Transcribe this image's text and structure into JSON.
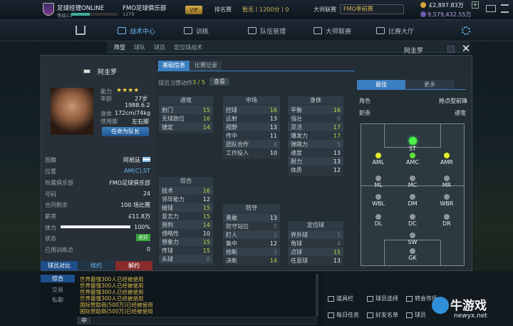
{
  "topbar": {
    "game_title": "足球经理ONLINE",
    "level": "等级11",
    "club_name": "FMO足球俱乐部",
    "club_sub": "1279",
    "vip": "VIP",
    "rank_label": "排名赛",
    "rank_info": "暂无丨1200分丨0",
    "master_label": "大师联赛",
    "master_info": "FMO季前赛",
    "coins": "£2,897.83万",
    "money2": "9,579,432.55万"
  },
  "nav": {
    "tactics": "战术中心",
    "training": "训练",
    "team": "队伍管理",
    "master": "大师联赛",
    "match": "比赛大厅"
  },
  "subtabs": [
    "阵型",
    "球队",
    "球员",
    "定位球战术"
  ],
  "player": {
    "header_name": "阿圭罗",
    "name": "阿圭罗",
    "ability_label": "能力",
    "age_label": "年龄",
    "age": "27岁",
    "birth": "1988.6.2",
    "body_label": "身体",
    "body": "172cm/74kg",
    "foot_label": "惯用脚",
    "foot": "左右脚",
    "captain_btn": "任命为队长",
    "stars": "★★★★",
    "info": [
      {
        "k": "国籍",
        "v": "阿根廷"
      },
      {
        "k": "位置",
        "v": "AM(C),ST"
      },
      {
        "k": "所属俱乐部",
        "v": "FMO足球俱乐部"
      },
      {
        "k": "号码",
        "v": "24"
      },
      {
        "k": "合同剩余",
        "v": "100 场比赛"
      },
      {
        "k": "薪资",
        "v": "£11.8万"
      },
      {
        "k": "体力",
        "v": "100%"
      },
      {
        "k": "状态",
        "v": "良好"
      },
      {
        "k": "已用训练点",
        "v": "0"
      }
    ],
    "stamina": 100
  },
  "actions": {
    "compare": "球员对比",
    "renew": "续约",
    "release": "解约"
  },
  "tabs": {
    "basic": "基础信息",
    "records": "比赛记录"
  },
  "habit": {
    "label": "球员习惯动作",
    "value": "3 / 5",
    "view": "查看"
  },
  "attrs": {
    "attack": {
      "title": "进攻",
      "rows": [
        [
          "射门",
          "15"
        ],
        [
          "无球跑位",
          "16"
        ],
        [
          "镇定",
          "14"
        ]
      ]
    },
    "general": {
      "title": "综合",
      "rows": [
        [
          "技术",
          "16"
        ],
        [
          "领导能力",
          "12"
        ],
        [
          "接球",
          "15"
        ],
        [
          "意志力",
          "15"
        ],
        [
          "预判",
          "14"
        ],
        [
          "侵略性",
          "10"
        ],
        [
          "想象力",
          "15"
        ],
        [
          "传球",
          "15"
        ],
        [
          "头球",
          "8"
        ]
      ]
    },
    "midfield": {
      "title": "中场",
      "rows": [
        [
          "控球",
          "16"
        ],
        [
          "远射",
          "13"
        ],
        [
          "视野",
          "13"
        ],
        [
          "传中",
          "11"
        ],
        [
          "团队合作",
          "8"
        ],
        [
          "工作投入",
          "10"
        ]
      ]
    },
    "defense": {
      "title": "防守",
      "rows": [
        [
          "勇敢",
          "13"
        ],
        [
          "防守站位",
          "5"
        ],
        [
          "盯人",
          "2"
        ],
        [
          "集中",
          "12"
        ],
        [
          "抢断",
          "3"
        ],
        [
          "决断",
          "14"
        ]
      ]
    },
    "physical": {
      "title": "身体",
      "rows": [
        [
          "平衡",
          "16"
        ],
        [
          "强壮",
          "8"
        ],
        [
          "灵活",
          "17"
        ],
        [
          "爆发力",
          "17"
        ],
        [
          "弹跳力",
          "5"
        ],
        [
          "速度",
          "13"
        ],
        [
          "耐力",
          "13"
        ],
        [
          "体质",
          "12"
        ]
      ]
    },
    "setpiece": {
      "title": "定位球",
      "rows": [
        [
          "界外球",
          "1"
        ],
        [
          "角球",
          "4"
        ],
        [
          "点球",
          "15"
        ],
        [
          "任意球",
          "13"
        ]
      ]
    }
  },
  "right": {
    "tab_best": "最佳",
    "tab_more": "更多",
    "role_label": "角色",
    "role_value": "抢点型前锋",
    "duty_label": "职责",
    "duty_value": "进攻"
  },
  "positions": [
    {
      "n": "ST",
      "c": "big"
    },
    {
      "n": "AML",
      "c": "y"
    },
    {
      "n": "AMC",
      "c": "g"
    },
    {
      "n": "AMR",
      "c": "y"
    },
    {
      "n": "ML",
      "c": ""
    },
    {
      "n": "MC",
      "c": ""
    },
    {
      "n": "MR",
      "c": ""
    },
    {
      "n": "WBL",
      "c": ""
    },
    {
      "n": "DM",
      "c": ""
    },
    {
      "n": "WBR",
      "c": ""
    },
    {
      "n": "DL",
      "c": ""
    },
    {
      "n": "DC",
      "c": ""
    },
    {
      "n": "DR",
      "c": ""
    },
    {
      "n": "SW",
      "c": ""
    },
    {
      "n": "GK",
      "c": ""
    }
  ],
  "chat": {
    "tabs": [
      "综合",
      "交易",
      "私聊"
    ],
    "lines": [
      "世界最强300人已经被使用",
      "世界最强300人已经被使用",
      "世界最强300人已经被使用",
      "世界最强300人已经被使用",
      "国际赞助商(500万)已经被使用",
      "国际赞助商(500万)已经被使用"
    ],
    "input_label": "中"
  },
  "bottom_btns": [
    "道具栏",
    "球员选择",
    "转会市场",
    "每日任务",
    "好友名单",
    "球员"
  ],
  "watermark": {
    "brand": "牛游戏",
    "url": "newyx.net"
  }
}
